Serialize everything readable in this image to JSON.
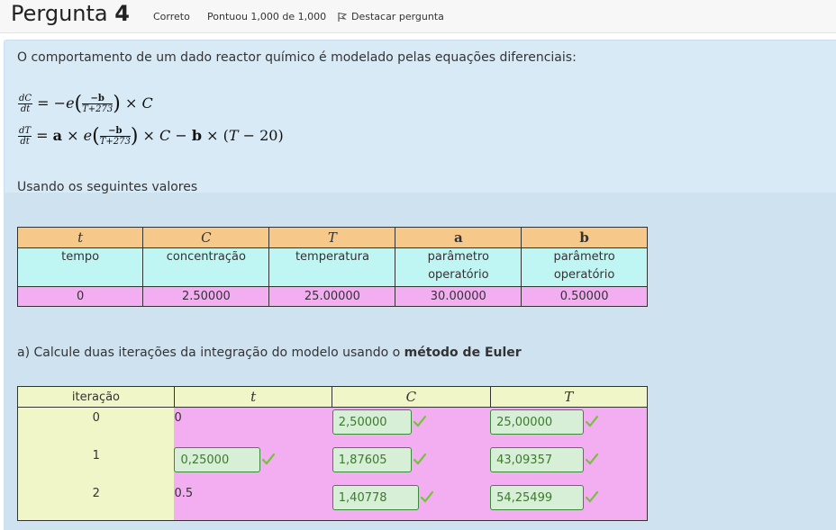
{
  "header": {
    "title_prefix": "Pergunta",
    "title_number": "4",
    "status": "Correto",
    "score": "Pontuou 1,000 de 1,000",
    "flag_label": "Destacar pergunta"
  },
  "question": {
    "intro": "O comportamento de um dado reactor químico é modelado pelas equações diferenciais:",
    "values_intro": "Usando os seguintes valores",
    "part_a_prefix": "a) Calcule duas iterações da integração do modelo usando o ",
    "part_a_bold": "método de Euler"
  },
  "params_table": {
    "symbols": [
      "t",
      "C",
      "T",
      "a",
      "b"
    ],
    "descriptions": [
      [
        "tempo",
        ""
      ],
      [
        "concentração",
        ""
      ],
      [
        "temperatura",
        ""
      ],
      [
        "parâmetro",
        "operatório"
      ],
      [
        "parâmetro",
        "operatório"
      ]
    ],
    "values": [
      "0",
      "2.50000",
      "25.00000",
      "30.00000",
      "0.50000"
    ]
  },
  "euler_table": {
    "headers": [
      "iteração",
      "t",
      "C",
      "T"
    ],
    "rows": [
      {
        "iter": "0",
        "t": "0",
        "C": "2,50000",
        "T": "25,00000"
      },
      {
        "iter": "1",
        "t": "0,25000",
        "C": "1,87605",
        "T": "43,09357"
      },
      {
        "iter": "2",
        "t": "0.5",
        "C": "1,40778",
        "T": "54,25499"
      }
    ]
  },
  "colors": {
    "correct": "#3d7a2c",
    "check": "#74c23b"
  }
}
